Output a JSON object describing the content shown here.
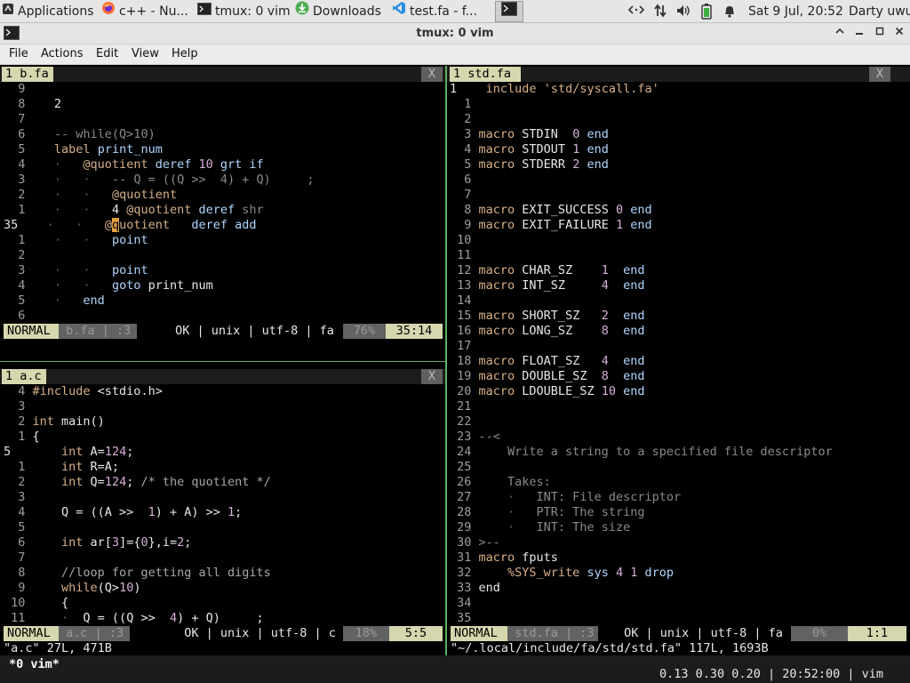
{
  "taskbar": {
    "items": [
      {
        "icon": "app-menu-icon",
        "label": "Applications"
      },
      {
        "icon": "firefox-icon",
        "label": "c++ - Nu..."
      },
      {
        "icon": "terminal-icon",
        "label": "tmux: 0 vim"
      },
      {
        "icon": "download-icon",
        "label": "Downloads"
      },
      {
        "icon": "vscode-icon",
        "label": "test.fa - f..."
      }
    ],
    "clock": "Sat  9 Jul, 20:52",
    "user": "Darty uwu"
  },
  "window": {
    "title": "tmux: 0 vim"
  },
  "menu": [
    "File",
    "Actions",
    "Edit",
    "View",
    "Help"
  ],
  "colors": {
    "accent_split": "#5faf5f",
    "statusline": "#d7d7af",
    "keyword": "#d7af87",
    "identifier": "#afd7ff",
    "number": "#d7afd7"
  },
  "panes": {
    "bfa": {
      "tab": "1 b.fa",
      "close": "X",
      "lines": [
        [
          [
            "lnum",
            "  9"
          ]
        ],
        [
          [
            "lnum",
            "  8"
          ],
          [
            "txt",
            "    2"
          ]
        ],
        [
          [
            "lnum",
            "  7"
          ]
        ],
        [
          [
            "lnum",
            "  6"
          ],
          [
            "txt",
            "    "
          ],
          [
            "cmt",
            "-- while(Q>10)"
          ]
        ],
        [
          [
            "lnum",
            "  5"
          ],
          [
            "txt",
            "    "
          ],
          [
            "kw",
            "label "
          ],
          [
            "id",
            "print_num"
          ]
        ],
        [
          [
            "lnum",
            "  4"
          ],
          [
            "txt",
            "    "
          ],
          [
            "dot",
            "·   "
          ],
          [
            "kw",
            "@quotient "
          ],
          [
            "id",
            "deref "
          ],
          [
            "num",
            "10 "
          ],
          [
            "id",
            "grt if"
          ]
        ],
        [
          [
            "lnum",
            "  3"
          ],
          [
            "txt",
            "    "
          ],
          [
            "dot",
            "·   ·   "
          ],
          [
            "cmt",
            "-- Q = ((Q >>  4) + Q)     ;"
          ]
        ],
        [
          [
            "lnum",
            "  2"
          ],
          [
            "txt",
            "    "
          ],
          [
            "dot",
            "·   ·   "
          ],
          [
            "kw",
            "@quotient"
          ]
        ],
        [
          [
            "lnum",
            "  1"
          ],
          [
            "txt",
            "    "
          ],
          [
            "dot",
            "·   ·   "
          ],
          [
            "txt",
            "4 "
          ],
          [
            "kw",
            "@quotient "
          ],
          [
            "id",
            "deref "
          ],
          [
            "cmt",
            "shr"
          ]
        ],
        [
          [
            "lnum-cur",
            "35 "
          ],
          [
            "txt",
            "   "
          ],
          [
            "dot",
            "·   ·   "
          ],
          [
            "kw",
            "@"
          ],
          [
            "cursor",
            "q"
          ],
          [
            "kw",
            "uotient   "
          ],
          [
            "id",
            "deref add"
          ]
        ],
        [
          [
            "lnum",
            "  1"
          ],
          [
            "txt",
            "    "
          ],
          [
            "dot",
            "·   ·   "
          ],
          [
            "id",
            "point"
          ]
        ],
        [
          [
            "lnum",
            "  2"
          ]
        ],
        [
          [
            "lnum",
            "  3"
          ],
          [
            "txt",
            "    "
          ],
          [
            "dot",
            "·   ·   "
          ],
          [
            "id",
            "point"
          ]
        ],
        [
          [
            "lnum",
            "  4"
          ],
          [
            "txt",
            "    "
          ],
          [
            "dot",
            "·   ·   "
          ],
          [
            "id",
            "goto "
          ],
          [
            "txt",
            "print_num"
          ]
        ],
        [
          [
            "lnum",
            "  5"
          ],
          [
            "txt",
            "    "
          ],
          [
            "dot",
            "·   "
          ],
          [
            "id",
            "end"
          ]
        ],
        [
          [
            "lnum",
            "  6"
          ]
        ]
      ],
      "status": {
        "mode": "NORMAL",
        "file": " b.fa | :3",
        "info": "OK | unix | utf-8 | fa ",
        "percent": "76%",
        "pos": "35:14"
      }
    },
    "ac": {
      "tab": "1 a.c",
      "close": "X",
      "lines": [
        [
          [
            "lnum",
            "  4 "
          ],
          [
            "kw",
            "#include "
          ],
          [
            "txt",
            "<stdio.h>"
          ]
        ],
        [
          [
            "lnum",
            "  3"
          ]
        ],
        [
          [
            "lnum",
            "  2 "
          ],
          [
            "kw",
            "int "
          ],
          [
            "txt",
            "main()"
          ]
        ],
        [
          [
            "lnum",
            "  1 "
          ],
          [
            "txt",
            "{"
          ]
        ],
        [
          [
            "lnum-cur",
            "5  "
          ],
          [
            "txt",
            "     "
          ],
          [
            "kw",
            "int "
          ],
          [
            "txt",
            "A="
          ],
          [
            "num",
            "124"
          ],
          [
            "txt",
            ";"
          ]
        ],
        [
          [
            "lnum",
            "  1 "
          ],
          [
            "txt",
            "    "
          ],
          [
            "kw",
            "int "
          ],
          [
            "txt",
            "R=A;"
          ]
        ],
        [
          [
            "lnum",
            "  2 "
          ],
          [
            "txt",
            "    "
          ],
          [
            "kw",
            "int "
          ],
          [
            "txt",
            "Q="
          ],
          [
            "num",
            "124"
          ],
          [
            "txt",
            "; "
          ],
          [
            "ccm",
            "/* the quotient */"
          ]
        ],
        [
          [
            "lnum",
            "  3"
          ]
        ],
        [
          [
            "lnum",
            "  4 "
          ],
          [
            "txt",
            "    Q = ((A >>  "
          ],
          [
            "num",
            "1"
          ],
          [
            "txt",
            ") + A) >> "
          ],
          [
            "num",
            "1"
          ],
          [
            "txt",
            ";"
          ]
        ],
        [
          [
            "lnum",
            "  5"
          ]
        ],
        [
          [
            "lnum",
            "  6 "
          ],
          [
            "txt",
            "    "
          ],
          [
            "kw",
            "int "
          ],
          [
            "txt",
            "ar["
          ],
          [
            "num",
            "3"
          ],
          [
            "txt",
            "]={"
          ],
          [
            "num",
            "0"
          ],
          [
            "txt",
            "},i="
          ],
          [
            "num",
            "2"
          ],
          [
            "txt",
            ";"
          ]
        ],
        [
          [
            "lnum",
            "  7"
          ]
        ],
        [
          [
            "lnum",
            "  8 "
          ],
          [
            "txt",
            "    "
          ],
          [
            "ccm",
            "//loop for getting all digits"
          ]
        ],
        [
          [
            "lnum",
            "  9 "
          ],
          [
            "txt",
            "    "
          ],
          [
            "kw",
            "while"
          ],
          [
            "txt",
            "(Q>"
          ],
          [
            "num",
            "10"
          ],
          [
            "txt",
            ")"
          ]
        ],
        [
          [
            "lnum",
            " 10 "
          ],
          [
            "txt",
            "    {"
          ]
        ],
        [
          [
            "lnum",
            " 11 "
          ],
          [
            "txt",
            "    "
          ],
          [
            "dot",
            "·  "
          ],
          [
            "txt",
            "Q = ((Q >>  "
          ],
          [
            "num",
            "4"
          ],
          [
            "txt",
            ") + Q)     ;"
          ]
        ]
      ],
      "status": {
        "mode": "NORMAL",
        "file": " a.c | :3",
        "info": "OK | unix | utf-8 | c ",
        "percent": "18%",
        "pos": "5:5"
      },
      "message": "\"a.c\" 27L, 471B"
    },
    "std": {
      "tab": "1 std.fa",
      "close": "X",
      "lines": [
        [
          [
            "lnum-cur",
            "1  "
          ],
          [
            "txt",
            "  "
          ],
          [
            "kw",
            "include "
          ],
          [
            "str",
            "'std/syscall.fa'"
          ]
        ],
        [
          [
            "lnum",
            "  1"
          ]
        ],
        [
          [
            "lnum",
            "  2"
          ]
        ],
        [
          [
            "lnum",
            "  3 "
          ],
          [
            "kw",
            "macro "
          ],
          [
            "txt",
            "STDIN  "
          ],
          [
            "num",
            "0 "
          ],
          [
            "id",
            "end"
          ]
        ],
        [
          [
            "lnum",
            "  4 "
          ],
          [
            "kw",
            "macro "
          ],
          [
            "txt",
            "STDOUT "
          ],
          [
            "num",
            "1 "
          ],
          [
            "id",
            "end"
          ]
        ],
        [
          [
            "lnum",
            "  5 "
          ],
          [
            "kw",
            "macro "
          ],
          [
            "txt",
            "STDERR "
          ],
          [
            "num",
            "2 "
          ],
          [
            "id",
            "end"
          ]
        ],
        [
          [
            "lnum",
            "  6"
          ]
        ],
        [
          [
            "lnum",
            "  7"
          ]
        ],
        [
          [
            "lnum",
            "  8 "
          ],
          [
            "kw",
            "macro "
          ],
          [
            "txt",
            "EXIT_SUCCESS "
          ],
          [
            "num",
            "0 "
          ],
          [
            "id",
            "end"
          ]
        ],
        [
          [
            "lnum",
            "  9 "
          ],
          [
            "kw",
            "macro "
          ],
          [
            "txt",
            "EXIT_FAILURE "
          ],
          [
            "num",
            "1 "
          ],
          [
            "id",
            "end"
          ]
        ],
        [
          [
            "lnum",
            " 10"
          ]
        ],
        [
          [
            "lnum",
            " 11"
          ]
        ],
        [
          [
            "lnum",
            " 12 "
          ],
          [
            "kw",
            "macro "
          ],
          [
            "txt",
            "CHAR_SZ    "
          ],
          [
            "num",
            "1  "
          ],
          [
            "id",
            "end"
          ]
        ],
        [
          [
            "lnum",
            " 13 "
          ],
          [
            "kw",
            "macro "
          ],
          [
            "txt",
            "INT_SZ     "
          ],
          [
            "num",
            "4  "
          ],
          [
            "id",
            "end"
          ]
        ],
        [
          [
            "lnum",
            " 14"
          ]
        ],
        [
          [
            "lnum",
            " 15 "
          ],
          [
            "kw",
            "macro "
          ],
          [
            "txt",
            "SHORT_SZ   "
          ],
          [
            "num",
            "2  "
          ],
          [
            "id",
            "end"
          ]
        ],
        [
          [
            "lnum",
            " 16 "
          ],
          [
            "kw",
            "macro "
          ],
          [
            "txt",
            "LONG_SZ    "
          ],
          [
            "num",
            "8  "
          ],
          [
            "id",
            "end"
          ]
        ],
        [
          [
            "lnum",
            " 17"
          ]
        ],
        [
          [
            "lnum",
            " 18 "
          ],
          [
            "kw",
            "macro "
          ],
          [
            "txt",
            "FLOAT_SZ   "
          ],
          [
            "num",
            "4  "
          ],
          [
            "id",
            "end"
          ]
        ],
        [
          [
            "lnum",
            " 19 "
          ],
          [
            "kw",
            "macro "
          ],
          [
            "txt",
            "DOUBLE_SZ  "
          ],
          [
            "num",
            "8  "
          ],
          [
            "id",
            "end"
          ]
        ],
        [
          [
            "lnum",
            " 20 "
          ],
          [
            "kw",
            "macro "
          ],
          [
            "txt",
            "LDOUBLE_SZ "
          ],
          [
            "num",
            "10 "
          ],
          [
            "id",
            "end"
          ]
        ],
        [
          [
            "lnum",
            " 21"
          ]
        ],
        [
          [
            "lnum",
            " 22"
          ]
        ],
        [
          [
            "lnum",
            " 23 "
          ],
          [
            "cmt",
            "--<"
          ]
        ],
        [
          [
            "lnum",
            " 24 "
          ],
          [
            "cmt",
            "    Write a string to a specified file descriptor"
          ]
        ],
        [
          [
            "lnum",
            " 25"
          ]
        ],
        [
          [
            "lnum",
            " 26 "
          ],
          [
            "cmt",
            "    Takes:"
          ]
        ],
        [
          [
            "lnum",
            " 27 "
          ],
          [
            "txt",
            "    "
          ],
          [
            "dot",
            "·   "
          ],
          [
            "cmt",
            "INT: File descriptor"
          ]
        ],
        [
          [
            "lnum",
            " 28 "
          ],
          [
            "txt",
            "    "
          ],
          [
            "dot",
            "·   "
          ],
          [
            "cmt",
            "PTR: The string"
          ]
        ],
        [
          [
            "lnum",
            " 29 "
          ],
          [
            "txt",
            "    "
          ],
          [
            "dot",
            "·   "
          ],
          [
            "cmt",
            "INT: The size"
          ]
        ],
        [
          [
            "lnum",
            " 30 "
          ],
          [
            "cmt",
            ">--"
          ]
        ],
        [
          [
            "lnum",
            " 31 "
          ],
          [
            "kw",
            "macro "
          ],
          [
            "txt",
            "fputs"
          ]
        ],
        [
          [
            "lnum",
            " 32 "
          ],
          [
            "txt",
            "    "
          ],
          [
            "kw",
            "%SYS_write "
          ],
          [
            "id",
            "sys "
          ],
          [
            "num",
            "4 1 "
          ],
          [
            "id",
            "drop"
          ]
        ],
        [
          [
            "lnum",
            " 33 "
          ],
          [
            "txt",
            "end"
          ]
        ],
        [
          [
            "lnum",
            " 34"
          ]
        ],
        [
          [
            "lnum",
            " 35"
          ]
        ]
      ],
      "status": {
        "mode": "NORMAL",
        "file": " std.fa | :3",
        "info": "OK | unix | utf-8 | fa ",
        "percent": "0%",
        "pos": "1:1"
      },
      "message": "\"~/.local/include/fa/std/std.fa\" 117L, 1693B"
    }
  },
  "tmux": {
    "window": "*0 vim*",
    "load": "0.13 0.30 0.20 | 20:52:00 | vim"
  }
}
